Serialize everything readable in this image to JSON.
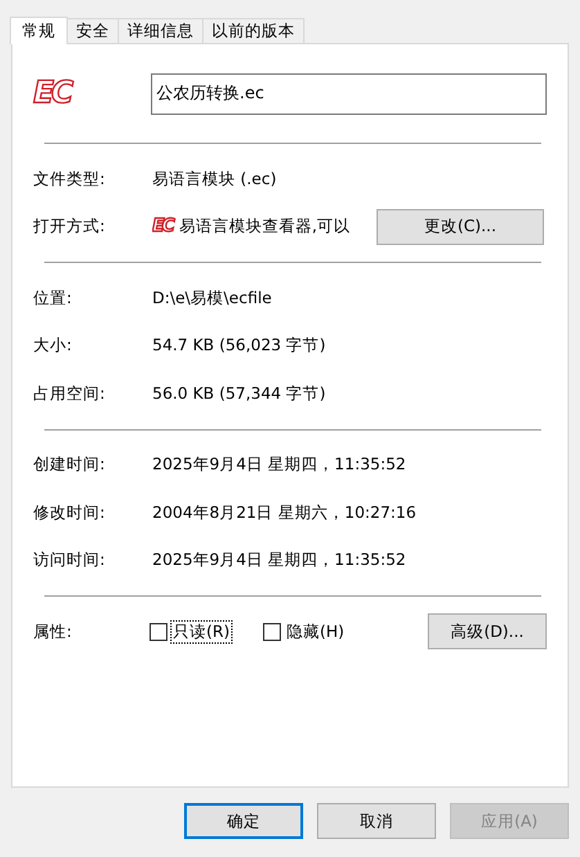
{
  "tabs": [
    {
      "label": "常规",
      "selected": true
    },
    {
      "label": "安全",
      "selected": false
    },
    {
      "label": "详细信息",
      "selected": false
    },
    {
      "label": "以前的版本",
      "selected": false
    }
  ],
  "file": {
    "icon_label": "EC",
    "name": "公农历转换.ec"
  },
  "sections": [
    [
      {
        "kind": "text",
        "label": "文件类型:",
        "value": "易语言模块 (.ec)"
      },
      {
        "kind": "app",
        "label": "打开方式:",
        "icon_label": "EC",
        "value": "易语言模块查看器,可以",
        "button": "更改(C)..."
      }
    ],
    [
      {
        "kind": "text",
        "label": "位置:",
        "value": "D:\\e\\易模\\ecfile"
      },
      {
        "kind": "text",
        "label": "大小:",
        "value": "54.7 KB (56,023 字节)"
      },
      {
        "kind": "text",
        "label": "占用空间:",
        "value": "56.0 KB (57,344 字节)"
      }
    ],
    [
      {
        "kind": "text",
        "label": "创建时间:",
        "value": "2025年9月4日 星期四，11:35:52"
      },
      {
        "kind": "text",
        "label": "修改时间:",
        "value": "2004年8月21日 星期六，10:27:16"
      },
      {
        "kind": "text",
        "label": "访问时间:",
        "value": "2025年9月4日 星期四，11:35:52"
      }
    ]
  ],
  "attributes": {
    "label": "属性:",
    "checkboxes": [
      {
        "label": "只读(R)",
        "checked": false,
        "focused": true
      },
      {
        "label": "隐藏(H)",
        "checked": false,
        "focused": false
      }
    ],
    "button": "高级(D)..."
  },
  "buttons": [
    {
      "label": "确定",
      "default": true,
      "disabled": false
    },
    {
      "label": "取消",
      "default": false,
      "disabled": false
    },
    {
      "label": "应用(A)",
      "default": false,
      "disabled": true
    }
  ]
}
